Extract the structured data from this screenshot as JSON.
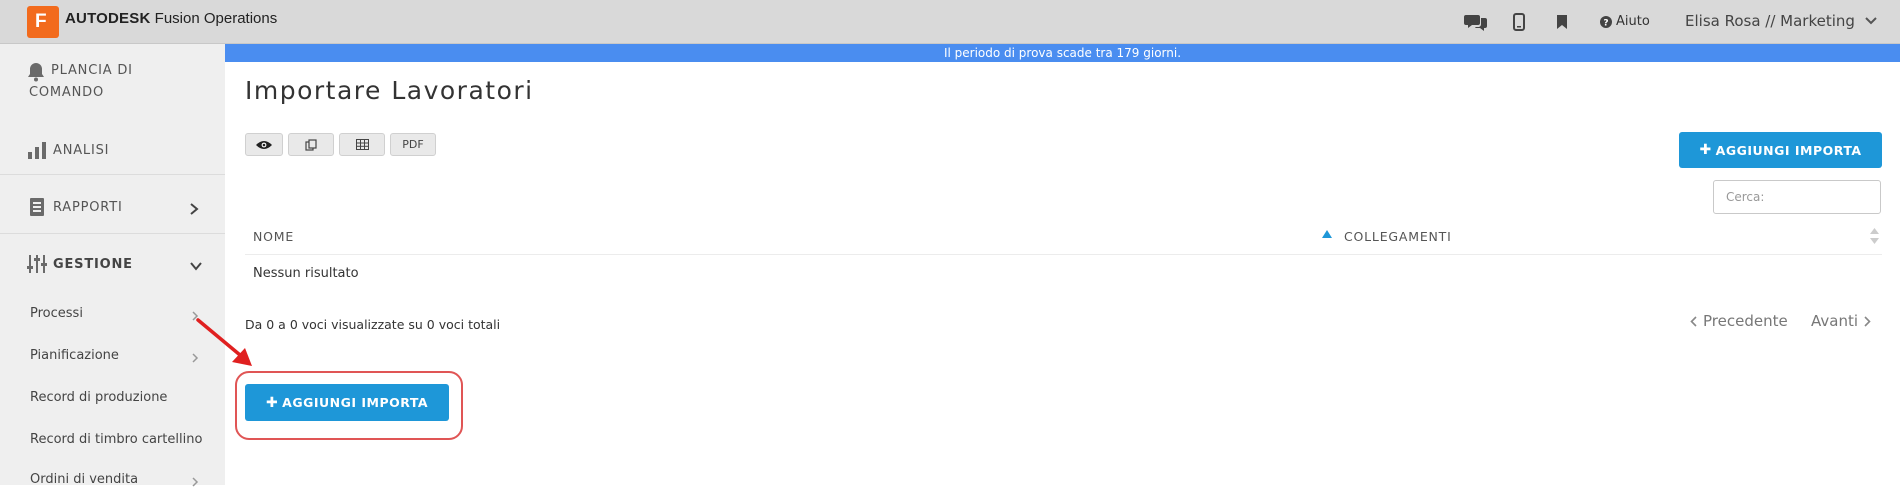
{
  "app": {
    "brand_bold": "AUTODESK",
    "brand_rest": "Fusion Operations",
    "logo_letter": "F",
    "help_label": "Aiuto",
    "user_label": "Elisa Rosa // Marketing"
  },
  "trial_banner": "Il periodo di prova scade tra 179 giorni.",
  "sidebar": {
    "main": [
      {
        "label_line1": "PLANCIA DI",
        "label_line2": "COMANDO",
        "icon": "bell-icon"
      },
      {
        "label": "ANALISI",
        "icon": "bar-chart-icon"
      },
      {
        "label": "RAPPORTI",
        "icon": "report-icon"
      },
      {
        "label": "GESTIONE",
        "icon": "sliders-icon"
      }
    ],
    "sub_items": [
      {
        "label": "Processi",
        "has_chevron": true
      },
      {
        "label": "Pianificazione",
        "has_chevron": true
      },
      {
        "label": "Record di produzione",
        "has_chevron": false
      },
      {
        "label": "Record di timbro cartellino",
        "has_chevron": false
      },
      {
        "label": "Ordini di vendita",
        "has_chevron": true
      }
    ]
  },
  "page": {
    "title": "Importare Lavoratori",
    "toolbar": {
      "view_icon": "eye-icon",
      "copy_icon": "copy-icon",
      "csv_icon": "table-icon",
      "pdf_label": "PDF"
    },
    "add_button_label": "AGGIUNGI IMPORTA",
    "search_placeholder": "Cerca:",
    "table": {
      "columns": [
        "NOME",
        "COLLEGAMENTI"
      ],
      "empty_message": "Nessun risultato"
    },
    "summary": "Da 0 a 0 voci visualizzate su 0 voci totali",
    "pagination": {
      "prev_label": "Precedente",
      "next_label": "Avanti"
    },
    "bottom_button_label": "AGGIUNGI IMPORTA"
  },
  "colors": {
    "accent": "#1e97d8",
    "banner": "#4a8df0",
    "logo": "#f26b1d",
    "highlight": "#e05555"
  }
}
